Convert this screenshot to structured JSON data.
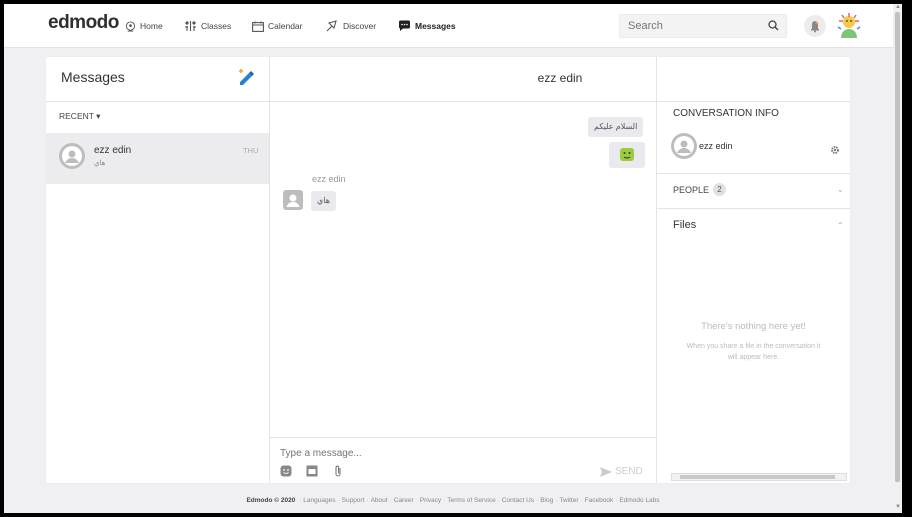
{
  "app": {
    "logo": "edmodo"
  },
  "nav": [
    {
      "label": "Home",
      "icon": "home-icon"
    },
    {
      "label": "Classes",
      "icon": "classes-icon"
    },
    {
      "label": "Calendar",
      "icon": "calendar-icon"
    },
    {
      "label": "Discover",
      "icon": "discover-icon"
    },
    {
      "label": "Messages",
      "icon": "messages-icon",
      "active": true
    }
  ],
  "search": {
    "placeholder": "Search"
  },
  "left": {
    "title": "Messages",
    "filter": "RECENT ▾",
    "conversations": [
      {
        "name": "ezz edin",
        "preview": "هاي",
        "time": "THU"
      }
    ]
  },
  "chat": {
    "title": "ezz edin",
    "sent_text": "السلام عليكم",
    "sender_name": "ezz edin",
    "received_text": "هاي",
    "composer_placeholder": "Type a message...",
    "send_label": "SEND"
  },
  "info": {
    "title": "CONVERSATION INFO",
    "user_name": "ezz edin",
    "people_label": "PEOPLE",
    "people_count": "2",
    "files_label": "Files",
    "empty_title": "There's nothing here yet!",
    "empty_text": "When you share a file in the conversation it will appear here."
  },
  "footer": {
    "copyright": "Edmodo © 2020",
    "links": [
      "Languages",
      "Support",
      "About",
      "Career",
      "Privacy",
      "Terms of Service",
      "Contact Us",
      "Blog",
      "Twitter",
      "Facebook",
      "Edmodo Labs"
    ]
  },
  "colors": {
    "sticker": "#9ccc3c",
    "compose_accent": "#2a7fd4",
    "compose_plus": "#f5a623"
  }
}
